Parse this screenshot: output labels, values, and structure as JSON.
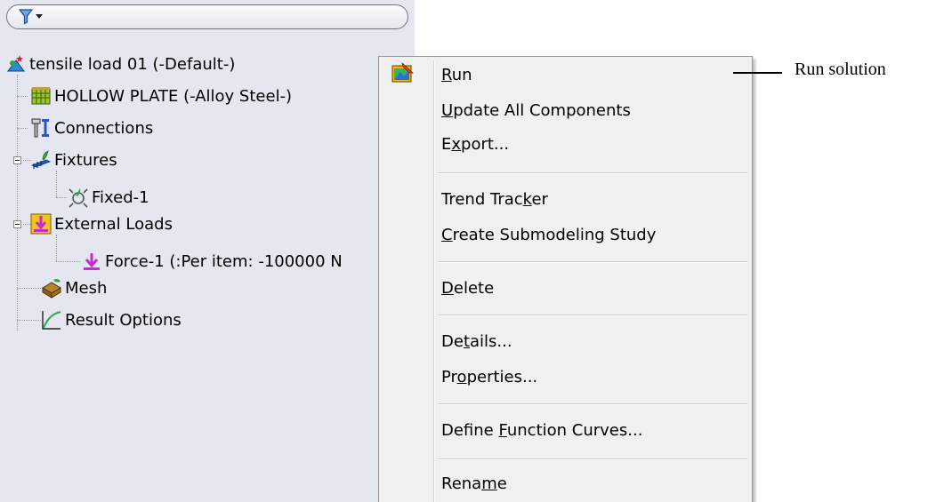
{
  "colors": {
    "panel_bg": "#e4e7ef",
    "menu_bg": "#f0f0f0"
  },
  "tree": {
    "root": {
      "label": "tensile load 01 (-Default-)",
      "icon": "study-icon"
    },
    "part": {
      "label": "HOLLOW PLATE (-Alloy Steel-)",
      "icon": "solid-body-icon"
    },
    "connections": {
      "label": "Connections",
      "icon": "connections-icon"
    },
    "fixtures": {
      "label": "Fixtures",
      "icon": "fixtures-icon"
    },
    "fixed": {
      "label": "Fixed-1",
      "icon": "fixed-geometry-icon"
    },
    "external_loads": {
      "label": "External Loads",
      "icon": "external-loads-icon"
    },
    "force": {
      "label": "Force-1 (:Per item: -100000 N",
      "icon": "force-arrow-icon"
    },
    "mesh": {
      "label": "Mesh",
      "icon": "mesh-icon"
    },
    "result_options": {
      "label": "Result Options",
      "icon": "result-curve-icon"
    }
  },
  "menu": {
    "run": {
      "pre": "",
      "key": "R",
      "post": "un",
      "icon": "run-study-icon"
    },
    "update": {
      "pre": "",
      "key": "U",
      "post": "pdate All Components"
    },
    "export": {
      "pre": "E",
      "key": "x",
      "post": "port..."
    },
    "trend": {
      "pre": "Trend Trac",
      "key": "k",
      "post": "er"
    },
    "submodel": {
      "pre": "",
      "key": "C",
      "post": "reate Submodeling Study"
    },
    "delete": {
      "pre": "",
      "key": "D",
      "post": "elete"
    },
    "details": {
      "pre": "De",
      "key": "t",
      "post": "ails..."
    },
    "properties": {
      "pre": "Pr",
      "key": "o",
      "post": "perties..."
    },
    "curves": {
      "pre": "Define ",
      "key": "F",
      "post": "unction Curves..."
    },
    "rename": {
      "pre": "Rena",
      "key": "m",
      "post": "e"
    }
  },
  "callout": {
    "text": "Run solution"
  }
}
